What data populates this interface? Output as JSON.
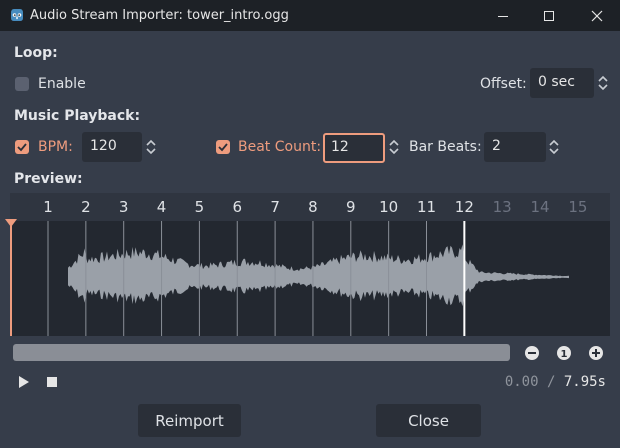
{
  "window": {
    "title": "Audio Stream Importer: tower_intro.ogg"
  },
  "loop": {
    "section_label": "Loop:",
    "enable_label": "Enable",
    "enable_checked": false,
    "offset_label": "Offset:",
    "offset_value": "0 sec"
  },
  "music": {
    "section_label": "Music Playback:",
    "bpm_label": "BPM:",
    "bpm_checked": true,
    "bpm_value": "120",
    "beat_count_label": "Beat Count:",
    "beat_count_checked": true,
    "beat_count_value": "12",
    "bar_beats_label": "Bar Beats:",
    "bar_beats_value": "2"
  },
  "preview": {
    "section_label": "Preview:",
    "beat_numbers": [
      "1",
      "2",
      "3",
      "4",
      "5",
      "6",
      "7",
      "8",
      "9",
      "10",
      "11",
      "12",
      "13",
      "14",
      "15"
    ],
    "active_beats": 12,
    "zoom_level": "1",
    "current_time": "0.00",
    "separator": "/",
    "total_time": "7.95s"
  },
  "buttons": {
    "reimport": "Reimport",
    "close": "Close"
  },
  "colors": {
    "accent": "#ee9c7e",
    "background": "#363d4a",
    "field": "#2a2f38",
    "titlebar": "#1d2126",
    "waveform": "#9aa0a8"
  }
}
